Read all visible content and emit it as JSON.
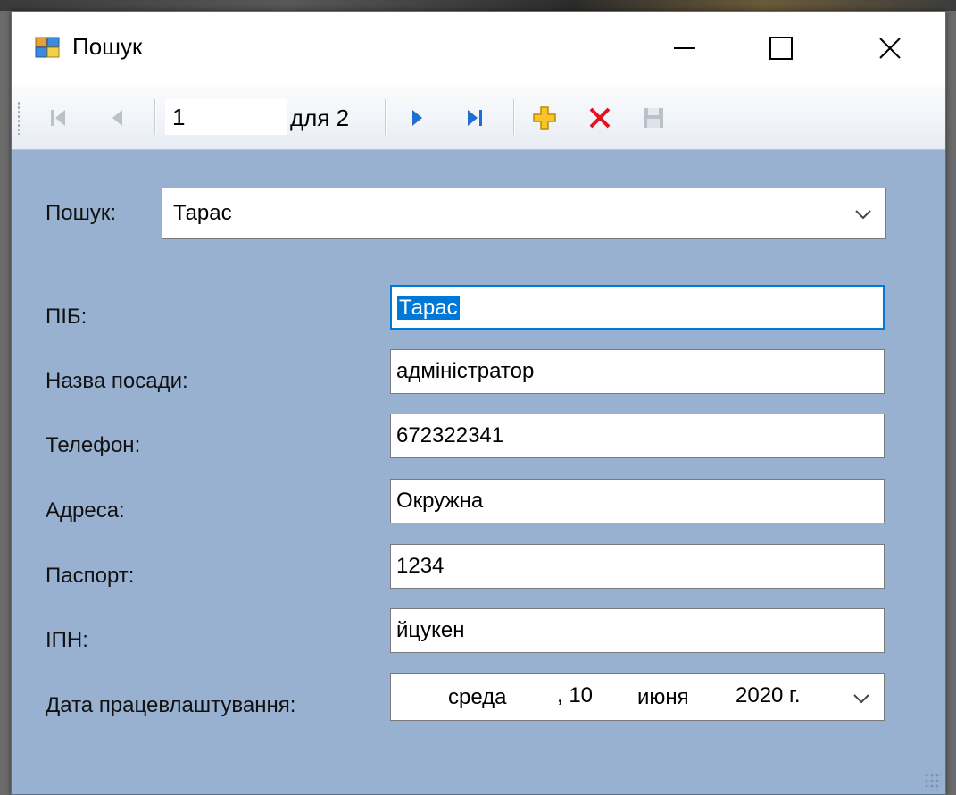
{
  "window": {
    "title": "Пошук"
  },
  "navigator": {
    "position": "1",
    "count_label": "для 2"
  },
  "search": {
    "label": "Пошук:",
    "value": "Тарас"
  },
  "form": {
    "name": {
      "label": "ПІБ:",
      "value": "Тарас"
    },
    "position": {
      "label": "Назва посади:",
      "value": "адміністратор"
    },
    "phone": {
      "label": "Телефон:",
      "value": "672322341"
    },
    "address": {
      "label": "Адреса:",
      "value": "Окружна"
    },
    "passport": {
      "label": "Паспорт:",
      "value": "1234"
    },
    "ipn": {
      "label": "ІПН:",
      "value": "йцукен"
    },
    "hire_date": {
      "label": "Дата працевлаштування:",
      "weekday": "среда",
      "day": ", 10",
      "month": "июня",
      "year": "2020 г."
    }
  },
  "colors": {
    "form_background": "#98b1d0",
    "selection": "#0078d7",
    "delete_icon": "#e81123",
    "add_icon": "#f5b500",
    "nav_icon": "#1e6fcf"
  },
  "icons": {
    "app": "app-icon",
    "minimize": "minimize-icon",
    "maximize": "maximize-icon",
    "close": "close-icon",
    "move_first": "move-first-icon",
    "move_prev": "move-previous-icon",
    "move_next": "move-next-icon",
    "move_last": "move-last-icon",
    "add": "add-new-icon",
    "delete": "delete-icon",
    "save": "save-icon"
  }
}
